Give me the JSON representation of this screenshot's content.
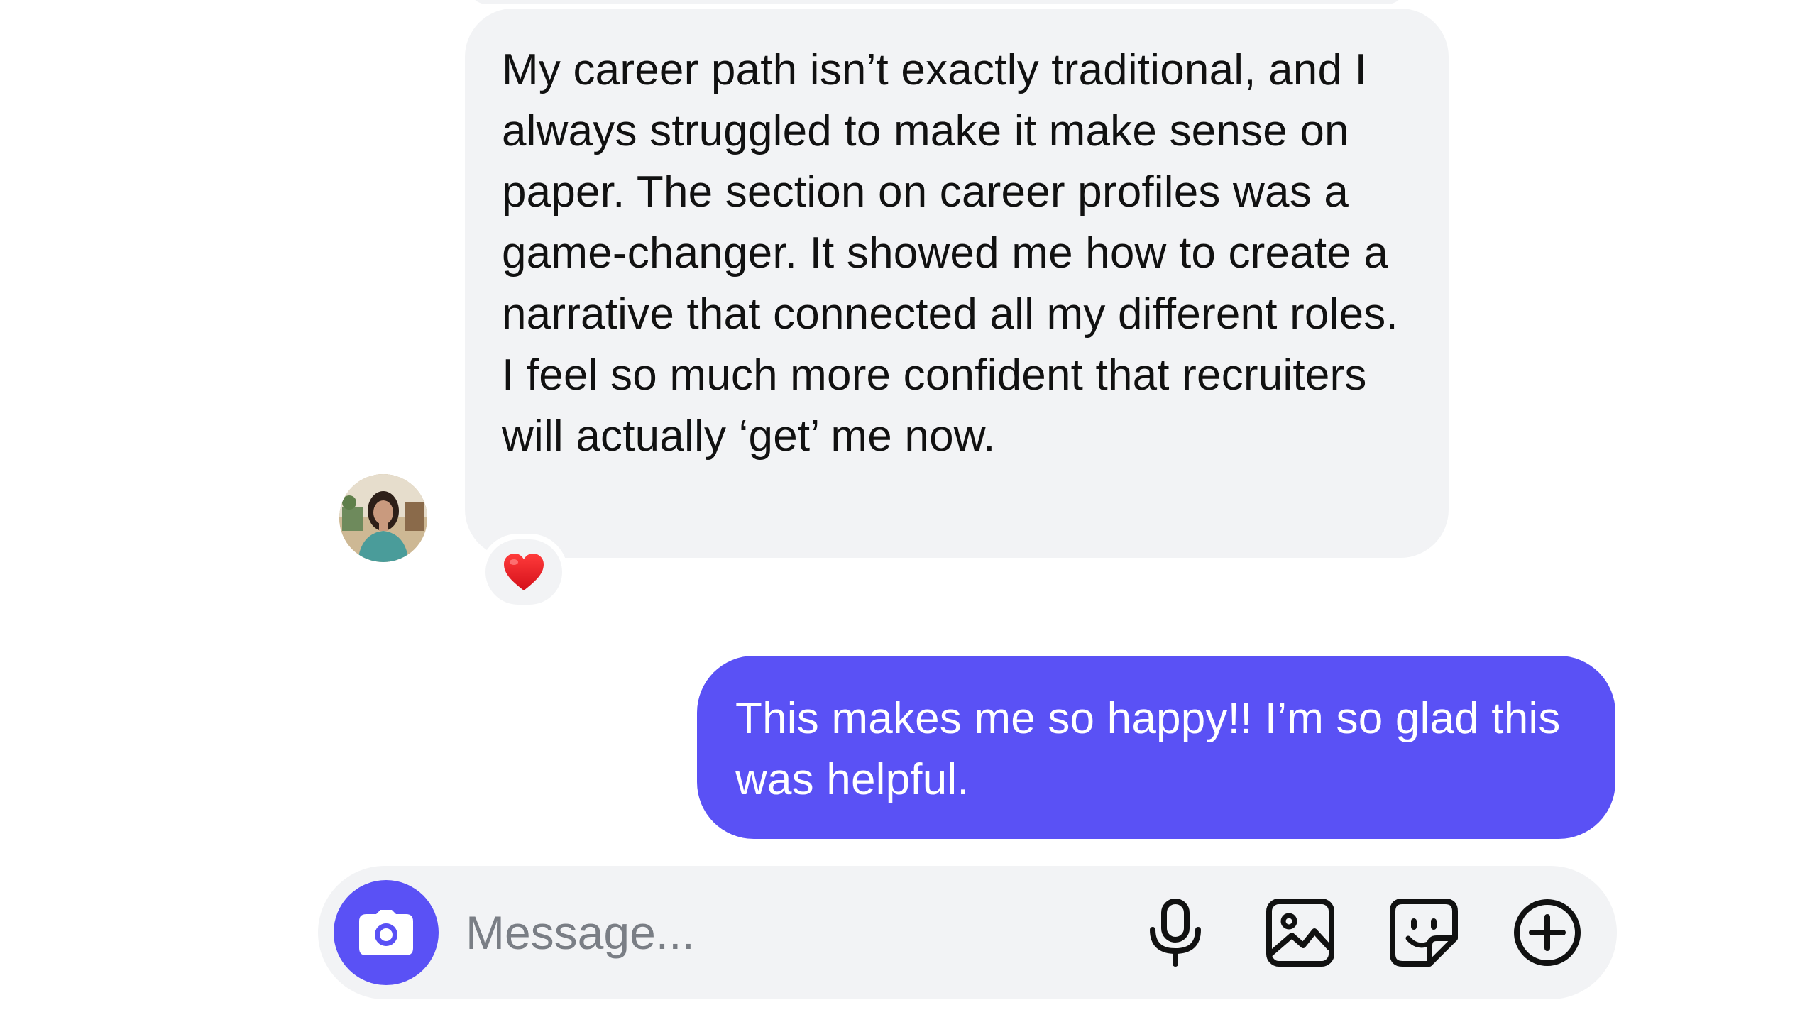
{
  "conversation": {
    "incoming_message": {
      "text": "My career path isn’t exactly traditional, and I always struggled to make it make sense on paper. The section on career profiles was a game-changer. It showed me how to create a narrative that connected all my different roles. I feel so much more confident that recruiters will actually ‘get’ me now.",
      "reaction": "❤️"
    },
    "outgoing_message": {
      "text": "This makes me so happy!! I’m so glad this was helpful."
    }
  },
  "composer": {
    "placeholder": "Message...",
    "value": ""
  },
  "icons": {
    "camera": "camera-icon",
    "microphone": "microphone-icon",
    "gallery": "image-gallery-icon",
    "sticker": "sticker-icon",
    "more": "plus-circle-icon"
  },
  "colors": {
    "accent": "#5a51f5",
    "bubble_incoming": "#f2f3f5",
    "text_primary": "#111111",
    "placeholder": "#7a7e85"
  }
}
